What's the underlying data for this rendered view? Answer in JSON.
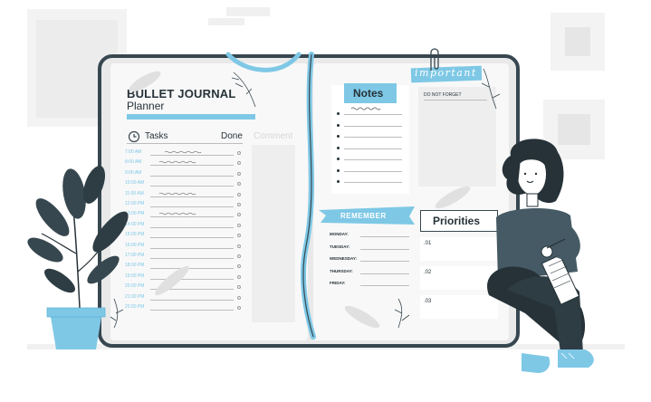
{
  "journal": {
    "title": "BULLET JOURNAL",
    "subtitle": "Planner",
    "tasks_header": "Tasks",
    "done_header": "Done",
    "comment_header": "Comment",
    "times": [
      "7:00 AM",
      "8:00 AM",
      "9:00 AM",
      "10:00 AM",
      "11:00 AM",
      "12:00 PM",
      "13:00 PM",
      "14:00 PM",
      "15:00 PM",
      "16:00 PM",
      "17:00 PM",
      "18:00 PM",
      "19:00 PM",
      "20:00 PM",
      "21:00 PM",
      "22:00 PM"
    ]
  },
  "notes": {
    "title": "Notes",
    "bullet_count": 7
  },
  "important": {
    "title": "important",
    "subtitle": "DO NOT FORGET"
  },
  "remember": {
    "title": "REMEMBER",
    "days": [
      "MONDAY:",
      "TUESDAY:",
      "WEDNESDAY:",
      "THURSDAY:",
      "FRIDAY:"
    ]
  },
  "priorities": {
    "title": "Priorities",
    "items": [
      ".01",
      ".02",
      ".03"
    ]
  },
  "colors": {
    "accent": "#7ec8e6",
    "accent_dark": "#4fa8d0",
    "dark": "#37474f",
    "frame": "#e9e9e9",
    "paper": "#f7f7f7",
    "line": "#cfcfcf"
  }
}
